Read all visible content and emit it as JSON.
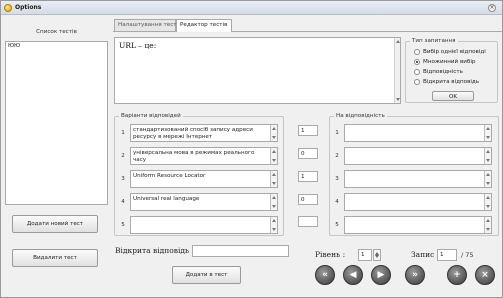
{
  "window": {
    "title": "Options",
    "close_glyph": "×"
  },
  "left": {
    "header": "Список тестів",
    "list_items": [
      "ЮЮ"
    ],
    "add_test": "Додати новий тест",
    "delete_test": "Видалити тест"
  },
  "tabs": [
    {
      "label": "Налаштування тесту"
    },
    {
      "label": "Редактор тестів"
    }
  ],
  "question": {
    "text": "URL – це:"
  },
  "qtype": {
    "legend": "Тип запитання",
    "options": [
      {
        "label": "Вибір однієї відповіді",
        "selected": false
      },
      {
        "label": "Множинний вибір",
        "selected": true
      },
      {
        "label": "Відповідність",
        "selected": false
      },
      {
        "label": "Відкрита відповідь",
        "selected": false
      }
    ],
    "ok": "OK"
  },
  "variants": {
    "legend": "Варіанти відповідей",
    "rows": [
      {
        "num": "1",
        "text": "стандартизований спосіб запису адреси ресурсу в мережі Інтернет",
        "score": "1"
      },
      {
        "num": "2",
        "text": "універсальна мова в режимах реального часу",
        "score": "0"
      },
      {
        "num": "3",
        "text": "Uniform Resource Locator",
        "score": "1"
      },
      {
        "num": "4",
        "text": "Universal real language",
        "score": "0"
      },
      {
        "num": "5",
        "text": "",
        "score": ""
      }
    ]
  },
  "matches": {
    "legend": "На відповідність",
    "rows": [
      {
        "num": "1",
        "text": ""
      },
      {
        "num": "2",
        "text": ""
      },
      {
        "num": "3",
        "text": ""
      },
      {
        "num": "4",
        "text": ""
      },
      {
        "num": "5",
        "text": ""
      }
    ]
  },
  "open_answer": {
    "label": "Відкрита відповідь",
    "value": ""
  },
  "add_to_test": "Додати в тест",
  "level": {
    "label": "Рівень :",
    "value": "1"
  },
  "record": {
    "label": "Запис",
    "value": "1",
    "total": "/ 75"
  },
  "nav": {
    "first": "«",
    "prev": "◀",
    "next": "▶",
    "last": "»",
    "add": "+",
    "delete": "×"
  },
  "colors": {
    "accent": "#555555"
  }
}
